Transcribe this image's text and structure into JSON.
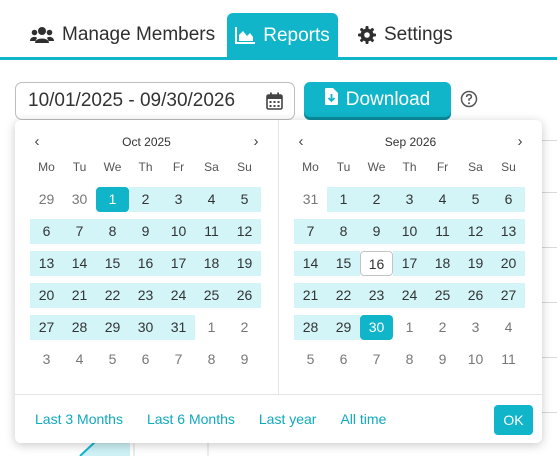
{
  "tabs": [
    {
      "label": "Manage Members",
      "icon": "users-icon"
    },
    {
      "label": "Reports",
      "icon": "area-chart-icon",
      "active": true
    },
    {
      "label": "Settings",
      "icon": "gear-icon"
    }
  ],
  "date_range": {
    "value": "10/01/2025 - 09/30/2026",
    "icon": "calendar-icon"
  },
  "download_label": "Download",
  "help_icon": "question-circle-icon",
  "weekdays": [
    "Mo",
    "Tu",
    "We",
    "Th",
    "Fr",
    "Sa",
    "Su"
  ],
  "calendars": [
    {
      "title": "Oct 2025",
      "days": [
        [
          "29",
          "30",
          "1",
          "2",
          "3",
          "4",
          "5"
        ],
        [
          "6",
          "7",
          "8",
          "9",
          "10",
          "11",
          "12"
        ],
        [
          "13",
          "14",
          "15",
          "16",
          "17",
          "18",
          "19"
        ],
        [
          "20",
          "21",
          "22",
          "23",
          "24",
          "25",
          "26"
        ],
        [
          "27",
          "28",
          "29",
          "30",
          "31",
          "1",
          "2"
        ],
        [
          "3",
          "4",
          "5",
          "6",
          "7",
          "8",
          "9"
        ]
      ],
      "in_range_from": [
        0,
        2
      ],
      "in_range_to": [
        4,
        4
      ],
      "selected": [
        0,
        2
      ]
    },
    {
      "title": "Sep 2026",
      "days": [
        [
          "31",
          "1",
          "2",
          "3",
          "4",
          "5",
          "6"
        ],
        [
          "7",
          "8",
          "9",
          "10",
          "11",
          "12",
          "13"
        ],
        [
          "14",
          "15",
          "16",
          "17",
          "18",
          "19",
          "20"
        ],
        [
          "21",
          "22",
          "23",
          "24",
          "25",
          "26",
          "27"
        ],
        [
          "28",
          "29",
          "30",
          "1",
          "2",
          "3",
          "4"
        ],
        [
          "5",
          "6",
          "7",
          "8",
          "9",
          "10",
          "11"
        ]
      ],
      "in_range_from": [
        0,
        1
      ],
      "in_range_to": [
        4,
        2
      ],
      "selected": [
        4,
        2
      ],
      "today": [
        2,
        2
      ]
    }
  ],
  "presets": [
    "Last 3 Months",
    "Last 6 Months",
    "Last year",
    "All time"
  ],
  "ok_label": "OK",
  "colors": {
    "accent": "#10b5c9",
    "range": "#d4f5f8"
  }
}
